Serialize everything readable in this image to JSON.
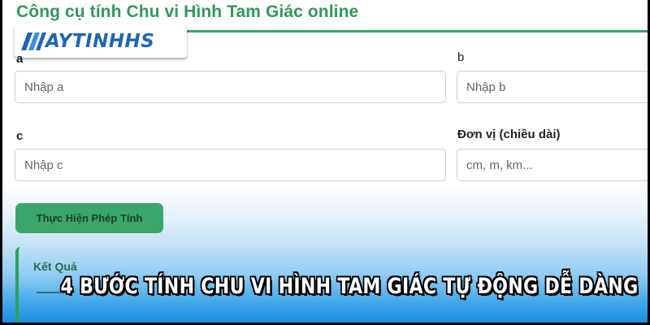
{
  "header": {
    "title": "Công cụ tính Chu vi Hình Tam Giác online",
    "logo_text": "AYTINHHS"
  },
  "form": {
    "field_a": {
      "label": "a",
      "placeholder": "Nhập a"
    },
    "field_b": {
      "label": "b",
      "placeholder": "Nhập b"
    },
    "field_c": {
      "label": "c",
      "placeholder": "Nhập c"
    },
    "field_unit": {
      "label": "Đơn vị (chiều dài)",
      "placeholder": "cm, m, km..."
    },
    "submit_label": "Thực Hiện Phép Tính"
  },
  "result": {
    "title": "Kết Quả"
  },
  "banner": {
    "text": "4 BƯỚC TÍNH CHU VI HÌNH TAM GIÁC TỰ ĐỘNG DỄ DÀNG"
  },
  "colors": {
    "accent_green": "#36a862",
    "button_green": "#3aa66a",
    "logo_blue": "#1e66b5",
    "background_blue": "#1b8fe0"
  }
}
